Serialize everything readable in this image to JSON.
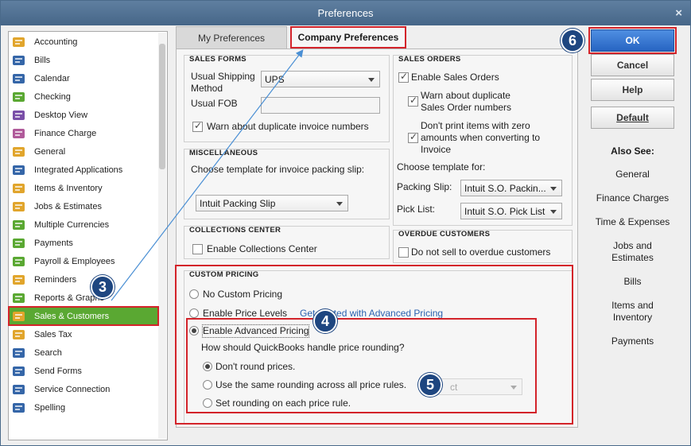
{
  "window": {
    "title": "Preferences",
    "close_glyph": "×"
  },
  "sidebar": {
    "items": [
      {
        "label": "Accounting",
        "icon": "accounting-icon"
      },
      {
        "label": "Bills",
        "icon": "bills-icon"
      },
      {
        "label": "Calendar",
        "icon": "calendar-icon"
      },
      {
        "label": "Checking",
        "icon": "checking-icon"
      },
      {
        "label": "Desktop View",
        "icon": "desktop-view-icon"
      },
      {
        "label": "Finance Charge",
        "icon": "finance-charge-icon"
      },
      {
        "label": "General",
        "icon": "general-icon"
      },
      {
        "label": "Integrated Applications",
        "icon": "integrated-applications-icon"
      },
      {
        "label": "Items & Inventory",
        "icon": "items-inventory-icon"
      },
      {
        "label": "Jobs & Estimates",
        "icon": "jobs-estimates-icon"
      },
      {
        "label": "Multiple Currencies",
        "icon": "multiple-currencies-icon"
      },
      {
        "label": "Payments",
        "icon": "payments-icon"
      },
      {
        "label": "Payroll & Employees",
        "icon": "payroll-employees-icon"
      },
      {
        "label": "Reminders",
        "icon": "reminders-icon"
      },
      {
        "label": "Reports & Graphs",
        "icon": "reports-graphs-icon"
      },
      {
        "label": "Sales & Customers",
        "icon": "sales-customers-icon",
        "selected": true
      },
      {
        "label": "Sales Tax",
        "icon": "sales-tax-icon"
      },
      {
        "label": "Search",
        "icon": "search-icon"
      },
      {
        "label": "Send Forms",
        "icon": "send-forms-icon"
      },
      {
        "label": "Service Connection",
        "icon": "service-connection-icon"
      },
      {
        "label": "Spelling",
        "icon": "spelling-icon"
      }
    ]
  },
  "tabs": {
    "my": "My Preferences",
    "company": "Company Preferences"
  },
  "sales_forms": {
    "title": "SALES FORMS",
    "shipping_label": "Usual Shipping Method",
    "shipping_value": "UPS",
    "fob_label": "Usual FOB",
    "fob_value": "",
    "warn_dup_label": "Warn about duplicate invoice numbers",
    "warn_dup_checked": true
  },
  "miscellaneous": {
    "title": "MISCELLANEOUS",
    "template_label": "Choose template for invoice packing slip:",
    "template_value": "Intuit Packing Slip"
  },
  "collections": {
    "title": "COLLECTIONS CENTER",
    "enable_label": "Enable Collections Center",
    "enable_checked": false
  },
  "sales_orders": {
    "title": "SALES ORDERS",
    "enable_label": "Enable Sales Orders",
    "enable_checked": true,
    "warn_dup_label": "Warn about duplicate Sales Order numbers",
    "warn_dup_checked": true,
    "dont_print_label": "Don't print items with zero amounts when converting to Invoice",
    "dont_print_checked": true,
    "choose_template_label": "Choose template for:",
    "packing_slip_label": "Packing Slip:",
    "packing_slip_value": "Intuit S.O. Packin...",
    "pick_list_label": "Pick List:",
    "pick_list_value": "Intuit S.O. Pick List"
  },
  "overdue": {
    "title": "OVERDUE CUSTOMERS",
    "do_not_sell_label": "Do not sell to overdue customers",
    "do_not_sell_checked": false
  },
  "custom_pricing": {
    "title": "CUSTOM PRICING",
    "no_custom_label": "No Custom Pricing",
    "enable_price_levels_label": "Enable Price Levels",
    "get_started_link": "Get started with Advanced Pricing",
    "enable_advanced_label": "Enable Advanced Pricing",
    "selected": "advanced",
    "rounding_question": "How should QuickBooks handle price rounding?",
    "dont_round_label": "Don't round prices.",
    "same_rounding_label": "Use the same rounding across all price rules.",
    "same_rounding_select": "ct",
    "each_rule_label": "Set rounding on each price rule.",
    "rounding_selected": "dont_round"
  },
  "buttons": {
    "ok": "OK",
    "cancel": "Cancel",
    "help": "Help",
    "default": "Default"
  },
  "also_see": {
    "title": "Also See:",
    "links": [
      "General",
      "Finance Charges",
      "Time & Expenses",
      "Jobs and Estimates",
      "Bills",
      "Items and Inventory",
      "Payments"
    ]
  },
  "callouts": {
    "three": "3",
    "four": "4",
    "five": "5",
    "six": "6"
  },
  "colors": {
    "accent_red": "#d3232a",
    "selected_green": "#5aa832",
    "ok_blue": "#2764c2",
    "badge_navy": "#1e4680",
    "link_blue": "#2a62b0"
  }
}
